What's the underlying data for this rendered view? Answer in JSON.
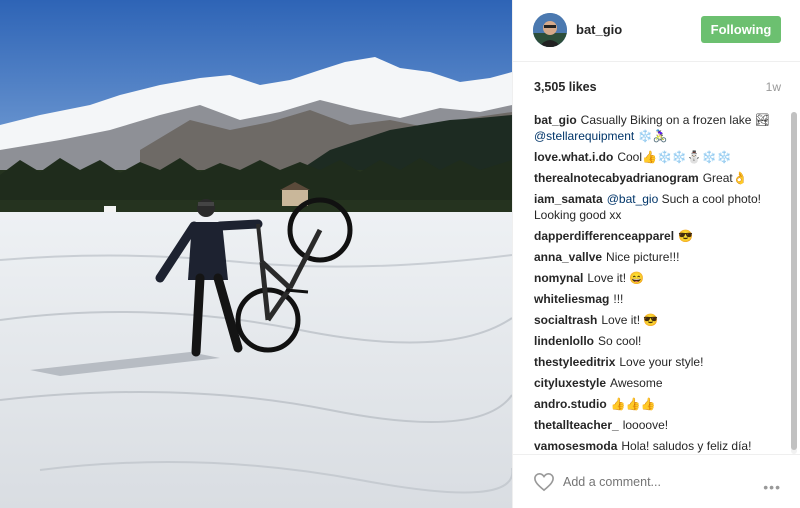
{
  "header": {
    "username": "bat_gio",
    "follow_label": "Following"
  },
  "post": {
    "likes": "3,505 likes",
    "time_ago": "1w"
  },
  "comments": [
    {
      "user": "bat_gio",
      "text": "Casually Biking on a frozen lake 🏞@stellarequipment ❄️🚴🏻‍♀️"
    },
    {
      "user": "love.what.i.do",
      "text": "Cool👍❄️❄️⛄️❄️❄️"
    },
    {
      "user": "therealnotecabyadrianogram",
      "text": "Great👌"
    },
    {
      "user": "iam_samata",
      "text": "@bat_gio Such a cool photo! Looking good xx"
    },
    {
      "user": "dapperdifferenceapparel",
      "text": "😎"
    },
    {
      "user": "anna_vallve",
      "text": "Nice picture!!!"
    },
    {
      "user": "nomynal",
      "text": "Love it! 😄"
    },
    {
      "user": "whiteliesmag",
      "text": "!!!"
    },
    {
      "user": "socialtrash",
      "text": "Love it! 😎"
    },
    {
      "user": "lindenlollo",
      "text": "So cool!"
    },
    {
      "user": "thestyleeditrix",
      "text": "Love your style!"
    },
    {
      "user": "cityluxestyle",
      "text": "Awesome"
    },
    {
      "user": "andro.studio",
      "text": "👍👍👍"
    },
    {
      "user": "thetallteacher_",
      "text": "loooove!"
    },
    {
      "user": "vamosesmoda",
      "text": "Hola! saludos y feliz día!"
    }
  ],
  "footer": {
    "add_comment_placeholder": "Add a comment...",
    "more_label": "•••"
  },
  "icons": {
    "like": "heart-icon",
    "options": "more-options-icon"
  },
  "colors": {
    "follow_button": "#6cc070",
    "mention": "#003569",
    "muted": "#999999"
  }
}
